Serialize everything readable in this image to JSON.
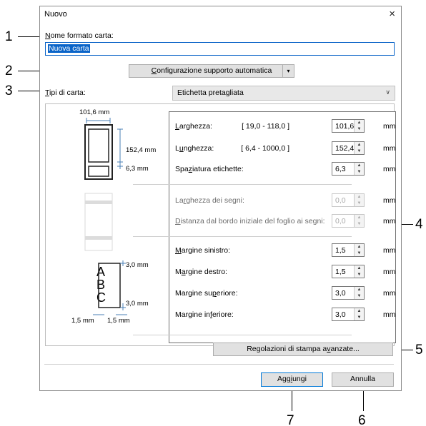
{
  "dialog": {
    "title": "Nuovo",
    "close_glyph": "×"
  },
  "paper_name": {
    "label_u": "N",
    "label_rest": "ome formato carta:",
    "value": "Nuova carta"
  },
  "auto_config": {
    "label_pre": "",
    "label_u": "C",
    "label_rest": "onfigurazione supporto automatica",
    "arrow": "▾"
  },
  "paper_type": {
    "label_u": "T",
    "label_rest": "ipi di carta:",
    "selected": "Etichetta pretagliata"
  },
  "fields": [
    {
      "pre": "",
      "u": "L",
      "post": "arghezza:",
      "range": "[ 19,0 - 118,0 ]",
      "value": "101,6",
      "unit": "mm"
    },
    {
      "pre": "L",
      "u": "u",
      "post": "nghezza:",
      "range": "[ 6,4 - 1000,0 ]",
      "value": "152,4",
      "unit": "mm"
    },
    {
      "pre": "Spa",
      "u": "z",
      "post": "iatura etichette:",
      "range": "",
      "value": "6,3",
      "unit": "mm"
    },
    {
      "pre": "La",
      "u": "r",
      "post": "ghezza dei segni:",
      "range": "",
      "value": "0,0",
      "unit": "mm"
    },
    {
      "pre": "",
      "u": "D",
      "post": "istanza dal bordo iniziale del foglio ai segni:",
      "range": "",
      "value": "0,0",
      "unit": "mm"
    },
    {
      "pre": "",
      "u": "M",
      "post": "argine sinistro:",
      "range": "",
      "value": "1,5",
      "unit": "mm"
    },
    {
      "pre": "M",
      "u": "a",
      "post": "rgine destro:",
      "range": "",
      "value": "1,5",
      "unit": "mm"
    },
    {
      "pre": "Margine su",
      "u": "p",
      "post": "eriore:",
      "range": "",
      "value": "3,0",
      "unit": "mm"
    },
    {
      "pre": "Margine in",
      "u": "f",
      "post": "eriore:",
      "range": "",
      "value": "3,0",
      "unit": "mm"
    }
  ],
  "preview": {
    "width_dim": "101,6 mm",
    "length_dim": "152,4 mm",
    "gap_dim": "6,3 mm",
    "top_margin_dim": "3,0 mm",
    "bottom_margin_dim": "3,0 mm",
    "left_margin_dim": "1,5 mm",
    "right_margin_dim": "1,5 mm",
    "letters": [
      "A",
      "B",
      "C"
    ]
  },
  "advanced_button": {
    "pre": "Regolazioni di stampa a",
    "u": "v",
    "post": "anzate..."
  },
  "add_button": {
    "pre": "Agg",
    "u": "i",
    "post": "ungi"
  },
  "cancel_button": {
    "label": "Annulla"
  },
  "callouts": [
    "1",
    "2",
    "3",
    "4",
    "5",
    "6",
    "7"
  ]
}
